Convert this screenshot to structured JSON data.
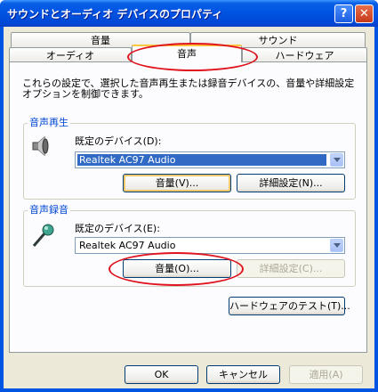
{
  "window": {
    "title": "サウンドとオーディオ デバイスのプロパティ",
    "help_label": "?",
    "close_label": "✕"
  },
  "tabs": {
    "row1": [
      "音量",
      "サウンド"
    ],
    "row2": [
      "オーディオ",
      "音声",
      "ハードウェア"
    ],
    "active": "音声"
  },
  "description": "これらの設定で、選択した音声再生または録音デバイスの、音量や詳細設定オプションを制御できます。",
  "playback": {
    "group_label": "音声再生",
    "device_label": "既定のデバイス(D):",
    "device_value": "Realtek AC97 Audio",
    "volume_button": "音量(V)...",
    "advanced_button": "詳細設定(N)..."
  },
  "recording": {
    "group_label": "音声録音",
    "device_label": "既定のデバイス(E):",
    "device_value": "Realtek AC97 Audio",
    "volume_button": "音量(O)...",
    "advanced_button": "詳細設定(C)..."
  },
  "hardware_test_button": "ハードウェアのテスト(T)...",
  "footer": {
    "ok": "OK",
    "cancel": "キャンセル",
    "apply": "適用(A)"
  },
  "colors": {
    "titlebar": "#0054e3",
    "group_label": "#0046d5",
    "annotation": "#e0141e",
    "selection": "#316ac5"
  }
}
